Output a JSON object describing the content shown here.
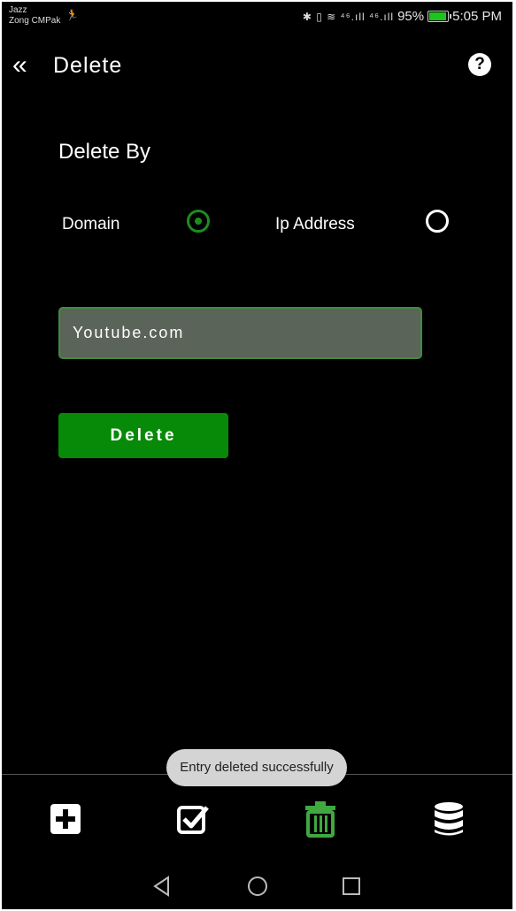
{
  "status_bar": {
    "carrier_1": "Jazz",
    "carrier_2": "Zong CMPak",
    "icons": "✱ ▯ ≋ ⁴⁶.ıll ⁴⁶.ıll",
    "battery": "95%",
    "battery_level": 0.95,
    "time": "5:05 PM"
  },
  "header": {
    "title": "Delete",
    "back_icon": "double-chevron-left-icon",
    "help_icon": "question-circle-icon"
  },
  "form": {
    "section_label": "Delete By",
    "options": [
      {
        "label": "Domain",
        "checked": true
      },
      {
        "label": "Ip Address",
        "checked": false
      }
    ],
    "input_value": "Youtube.com",
    "button_label": "Delete"
  },
  "toast": "Entry deleted successfully",
  "bottom_nav": {
    "items": [
      "add-icon",
      "checkbox-icon",
      "trash-icon",
      "database-icon"
    ],
    "active": "trash-icon",
    "active_color": "#3fa93f"
  },
  "colors": {
    "accent": "#078a07",
    "radio_checked": "#1e8c1e",
    "input_bg": "#5b6458",
    "input_border": "#3e8d3e"
  }
}
